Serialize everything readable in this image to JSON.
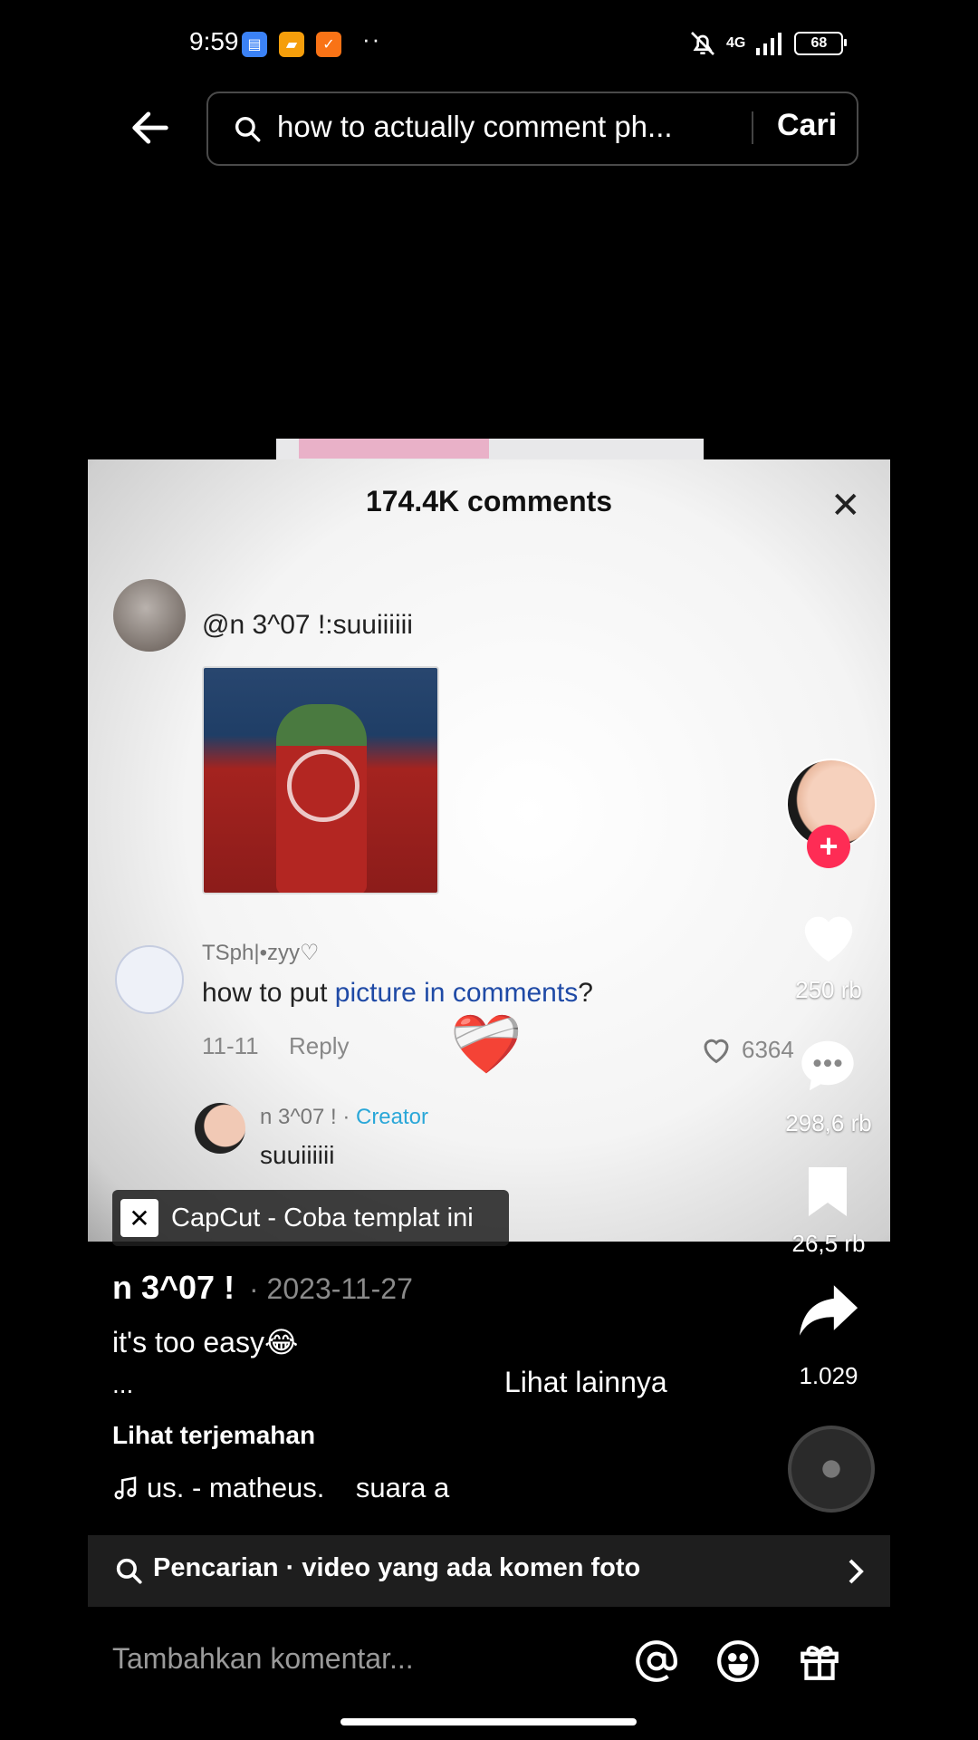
{
  "status": {
    "time": "9:59",
    "dots": "··",
    "network": "4G",
    "battery": "68"
  },
  "search": {
    "query": "how to actually comment ph...",
    "submit_label": "Cari"
  },
  "video": {
    "comments_count": "174.4K comments",
    "comment1_text": "@n 3^07 !:suuiiiiii",
    "comment2_user": "TSph|•zyy♡",
    "comment2_text_pre": "how to put ",
    "comment2_text_link": "picture in comments",
    "comment2_text_post": "?",
    "comment2_date": "11-11",
    "comment2_reply": "Reply",
    "comment2_likes": "6364",
    "reply_user": "n 3^07 !",
    "reply_separator": " · ",
    "reply_badge": "Creator",
    "reply_text": "suuiiiiii"
  },
  "actions": {
    "likes": "250 rb",
    "comments": "298,6 rb",
    "saves": "26,5 rb",
    "shares": "1.029"
  },
  "capcut": {
    "label": "CapCut - Coba templat ini"
  },
  "post": {
    "author": "n 3^07 !",
    "date": "· 2023-11-27",
    "caption": "it's too easy😂",
    "ellipsis": "...",
    "see_more": "Lihat lainnya",
    "translate": "Lihat terjemahan",
    "music": "us. - matheus.    suara a"
  },
  "related_search": {
    "label": "Pencarian · video yang ada komen foto"
  },
  "comment_bar": {
    "placeholder": "Tambahkan komentar..."
  },
  "colors": {
    "accent_red": "#fe2c55",
    "link_blue": "#1f4aa6",
    "creator_blue": "#2aa7d8"
  }
}
